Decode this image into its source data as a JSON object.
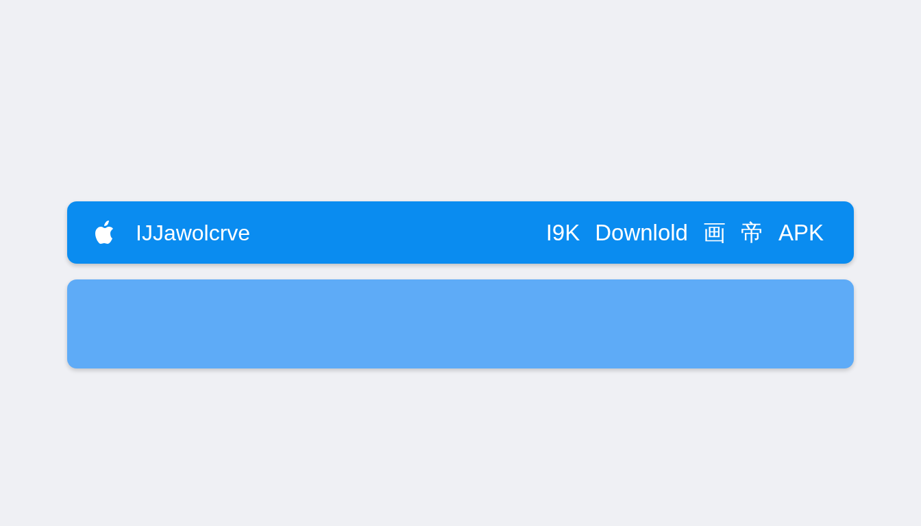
{
  "top_bar": {
    "title": "IJJawolcrve",
    "right_texts": [
      "I9K",
      "Downlold",
      "画",
      "帝",
      "APK"
    ]
  },
  "panel": {
    "kind": "blank"
  }
}
